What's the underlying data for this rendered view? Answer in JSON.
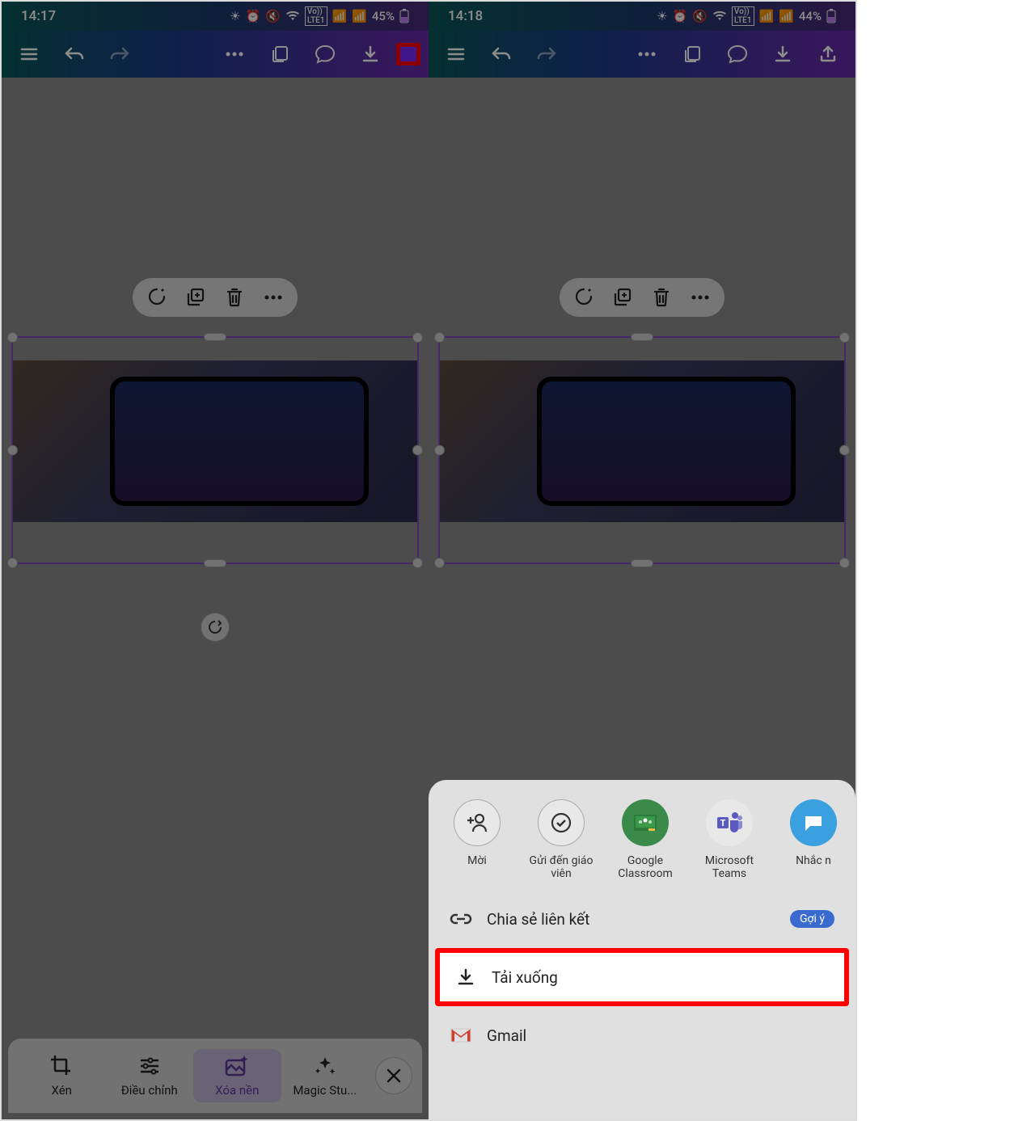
{
  "left": {
    "status": {
      "time": "14:17",
      "battery": "45%"
    },
    "bottomTools": {
      "crop": "Xén",
      "adjust": "Điều chỉnh",
      "removeBg": "Xóa nền",
      "magic": "Magic Stu..."
    }
  },
  "right": {
    "status": {
      "time": "14:18",
      "battery": "44%"
    },
    "shareApps": {
      "invite": "Mời",
      "sendTeacher": "Gửi đến giáo viên",
      "classroom": "Google Classroom",
      "teams": "Microsoft Teams",
      "remind": "Nhắc n"
    },
    "shareRows": {
      "link": "Chia sẻ liên kết",
      "suggest": "Gợi ý",
      "download": "Tải xuống",
      "gmail": "Gmail"
    }
  }
}
